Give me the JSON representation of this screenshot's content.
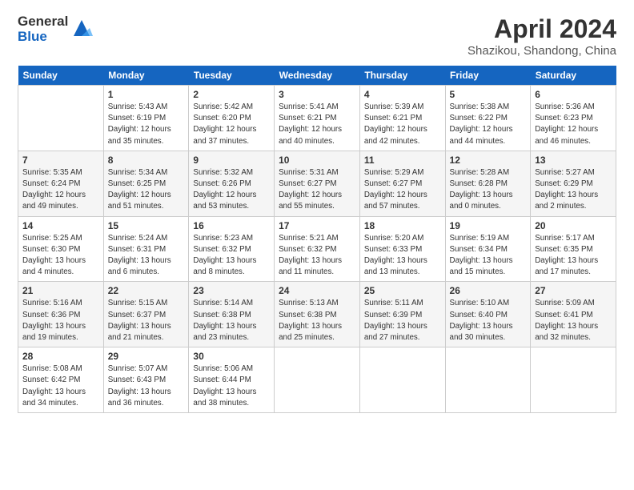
{
  "header": {
    "logo_general": "General",
    "logo_blue": "Blue",
    "month": "April 2024",
    "location": "Shazikou, Shandong, China"
  },
  "weekdays": [
    "Sunday",
    "Monday",
    "Tuesday",
    "Wednesday",
    "Thursday",
    "Friday",
    "Saturday"
  ],
  "weeks": [
    [
      {
        "day": "",
        "info": ""
      },
      {
        "day": "1",
        "info": "Sunrise: 5:43 AM\nSunset: 6:19 PM\nDaylight: 12 hours\nand 35 minutes."
      },
      {
        "day": "2",
        "info": "Sunrise: 5:42 AM\nSunset: 6:20 PM\nDaylight: 12 hours\nand 37 minutes."
      },
      {
        "day": "3",
        "info": "Sunrise: 5:41 AM\nSunset: 6:21 PM\nDaylight: 12 hours\nand 40 minutes."
      },
      {
        "day": "4",
        "info": "Sunrise: 5:39 AM\nSunset: 6:21 PM\nDaylight: 12 hours\nand 42 minutes."
      },
      {
        "day": "5",
        "info": "Sunrise: 5:38 AM\nSunset: 6:22 PM\nDaylight: 12 hours\nand 44 minutes."
      },
      {
        "day": "6",
        "info": "Sunrise: 5:36 AM\nSunset: 6:23 PM\nDaylight: 12 hours\nand 46 minutes."
      }
    ],
    [
      {
        "day": "7",
        "info": "Sunrise: 5:35 AM\nSunset: 6:24 PM\nDaylight: 12 hours\nand 49 minutes."
      },
      {
        "day": "8",
        "info": "Sunrise: 5:34 AM\nSunset: 6:25 PM\nDaylight: 12 hours\nand 51 minutes."
      },
      {
        "day": "9",
        "info": "Sunrise: 5:32 AM\nSunset: 6:26 PM\nDaylight: 12 hours\nand 53 minutes."
      },
      {
        "day": "10",
        "info": "Sunrise: 5:31 AM\nSunset: 6:27 PM\nDaylight: 12 hours\nand 55 minutes."
      },
      {
        "day": "11",
        "info": "Sunrise: 5:29 AM\nSunset: 6:27 PM\nDaylight: 12 hours\nand 57 minutes."
      },
      {
        "day": "12",
        "info": "Sunrise: 5:28 AM\nSunset: 6:28 PM\nDaylight: 13 hours\nand 0 minutes."
      },
      {
        "day": "13",
        "info": "Sunrise: 5:27 AM\nSunset: 6:29 PM\nDaylight: 13 hours\nand 2 minutes."
      }
    ],
    [
      {
        "day": "14",
        "info": "Sunrise: 5:25 AM\nSunset: 6:30 PM\nDaylight: 13 hours\nand 4 minutes."
      },
      {
        "day": "15",
        "info": "Sunrise: 5:24 AM\nSunset: 6:31 PM\nDaylight: 13 hours\nand 6 minutes."
      },
      {
        "day": "16",
        "info": "Sunrise: 5:23 AM\nSunset: 6:32 PM\nDaylight: 13 hours\nand 8 minutes."
      },
      {
        "day": "17",
        "info": "Sunrise: 5:21 AM\nSunset: 6:32 PM\nDaylight: 13 hours\nand 11 minutes."
      },
      {
        "day": "18",
        "info": "Sunrise: 5:20 AM\nSunset: 6:33 PM\nDaylight: 13 hours\nand 13 minutes."
      },
      {
        "day": "19",
        "info": "Sunrise: 5:19 AM\nSunset: 6:34 PM\nDaylight: 13 hours\nand 15 minutes."
      },
      {
        "day": "20",
        "info": "Sunrise: 5:17 AM\nSunset: 6:35 PM\nDaylight: 13 hours\nand 17 minutes."
      }
    ],
    [
      {
        "day": "21",
        "info": "Sunrise: 5:16 AM\nSunset: 6:36 PM\nDaylight: 13 hours\nand 19 minutes."
      },
      {
        "day": "22",
        "info": "Sunrise: 5:15 AM\nSunset: 6:37 PM\nDaylight: 13 hours\nand 21 minutes."
      },
      {
        "day": "23",
        "info": "Sunrise: 5:14 AM\nSunset: 6:38 PM\nDaylight: 13 hours\nand 23 minutes."
      },
      {
        "day": "24",
        "info": "Sunrise: 5:13 AM\nSunset: 6:38 PM\nDaylight: 13 hours\nand 25 minutes."
      },
      {
        "day": "25",
        "info": "Sunrise: 5:11 AM\nSunset: 6:39 PM\nDaylight: 13 hours\nand 27 minutes."
      },
      {
        "day": "26",
        "info": "Sunrise: 5:10 AM\nSunset: 6:40 PM\nDaylight: 13 hours\nand 30 minutes."
      },
      {
        "day": "27",
        "info": "Sunrise: 5:09 AM\nSunset: 6:41 PM\nDaylight: 13 hours\nand 32 minutes."
      }
    ],
    [
      {
        "day": "28",
        "info": "Sunrise: 5:08 AM\nSunset: 6:42 PM\nDaylight: 13 hours\nand 34 minutes."
      },
      {
        "day": "29",
        "info": "Sunrise: 5:07 AM\nSunset: 6:43 PM\nDaylight: 13 hours\nand 36 minutes."
      },
      {
        "day": "30",
        "info": "Sunrise: 5:06 AM\nSunset: 6:44 PM\nDaylight: 13 hours\nand 38 minutes."
      },
      {
        "day": "",
        "info": ""
      },
      {
        "day": "",
        "info": ""
      },
      {
        "day": "",
        "info": ""
      },
      {
        "day": "",
        "info": ""
      }
    ]
  ]
}
